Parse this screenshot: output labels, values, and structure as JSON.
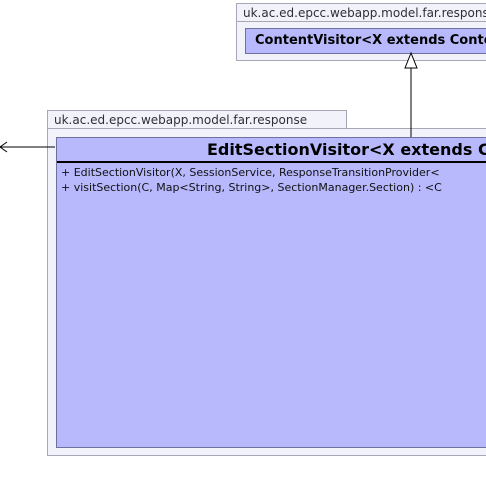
{
  "top_package": {
    "name": "uk.ac.ed.epcc.webapp.model.far.response",
    "class_name": "ContentVisitor<X extends Content"
  },
  "main_package": {
    "name": "uk.ac.ed.epcc.webapp.model.far.response",
    "class_name": "EditSectionVisitor<X extends Co",
    "operations": [
      "+ EditSectionVisitor(X, SessionService, ResponseTransitionProvider<",
      "+ visitSection(C, Map<String, String>, SectionManager.Section) : <C"
    ]
  },
  "colors": {
    "class_fill": "#b7b9fc",
    "package_fill": "#f2f2fb",
    "line": "#000000"
  }
}
